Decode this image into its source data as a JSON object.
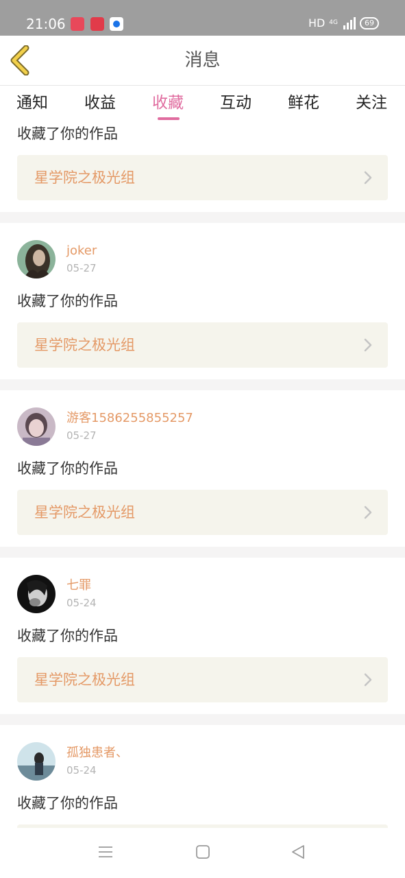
{
  "status": {
    "time": "21:06",
    "hd": "HD",
    "network": "4G",
    "battery": "69"
  },
  "header": {
    "title": "消息"
  },
  "tabs": [
    {
      "label": "通知"
    },
    {
      "label": "收益"
    },
    {
      "label": "收藏"
    },
    {
      "label": "互动"
    },
    {
      "label": "鲜花"
    },
    {
      "label": "关注"
    }
  ],
  "active_tab": "收藏",
  "notifications": [
    {
      "action": "收藏了你的作品",
      "work": "星学院之极光组"
    },
    {
      "user": "joker",
      "date": "05-27",
      "action": "收藏了你的作品",
      "work": "星学院之极光组"
    },
    {
      "user": "游客1586255855257",
      "date": "05-27",
      "action": "收藏了你的作品",
      "work": "星学院之极光组"
    },
    {
      "user": "七罪",
      "date": "05-24",
      "action": "收藏了你的作品",
      "work": "星学院之极光组"
    },
    {
      "user": "孤独患者、",
      "date": "05-24",
      "action": "收藏了你的作品",
      "work": ""
    }
  ],
  "colors": {
    "accent_pink": "#e06c9f",
    "username_orange": "#e49966",
    "work_box_bg": "#f5f4ec",
    "back_arrow_yellow": "#f2d04b"
  }
}
